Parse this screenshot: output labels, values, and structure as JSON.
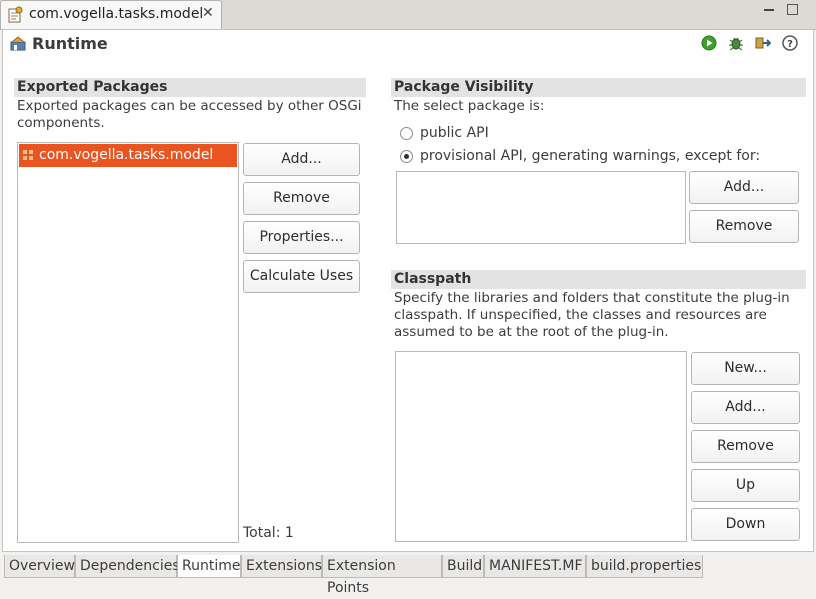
{
  "editor": {
    "tab_title": "com.vogella.tasks.model",
    "close_glyph": "✕"
  },
  "page": {
    "title": "Runtime"
  },
  "exported_packages": {
    "heading": "Exported Packages",
    "description": "Exported packages can be accessed by other OSGi components.",
    "items": [
      "com.vogella.tasks.model"
    ],
    "buttons": {
      "add": "Add...",
      "remove": "Remove",
      "properties": "Properties...",
      "calculate_uses": "Calculate Uses"
    },
    "total": "Total: 1"
  },
  "package_visibility": {
    "heading": "Package Visibility",
    "description": "The select package is:",
    "options": [
      {
        "label": "public API",
        "selected": false
      },
      {
        "label": "provisional API, generating warnings, except for:",
        "selected": true
      }
    ],
    "buttons": {
      "add": "Add...",
      "remove": "Remove"
    }
  },
  "classpath": {
    "heading": "Classpath",
    "description": "Specify the libraries and folders that constitute the plug-in classpath.  If unspecified, the classes and resources are assumed to be at the root of the plug-in.",
    "buttons": {
      "new": "New...",
      "add": "Add...",
      "remove": "Remove",
      "up": "Up",
      "down": "Down"
    }
  },
  "bottom_tabs": [
    {
      "label": "Overview",
      "active": false
    },
    {
      "label": "Dependencies",
      "active": false
    },
    {
      "label": "Runtime",
      "active": true
    },
    {
      "label": "Extensions",
      "active": false
    },
    {
      "label": "Extension Points",
      "active": false
    },
    {
      "label": "Build",
      "active": false
    },
    {
      "label": "MANIFEST.MF",
      "active": false
    },
    {
      "label": "build.properties",
      "active": false
    }
  ],
  "colors": {
    "selection": "#e95420",
    "run_green": "#3f9f2f",
    "section_header": "#e3e3e3"
  },
  "toolbar_icons": [
    "run-icon",
    "debug-icon",
    "export-icon",
    "help-icon"
  ]
}
